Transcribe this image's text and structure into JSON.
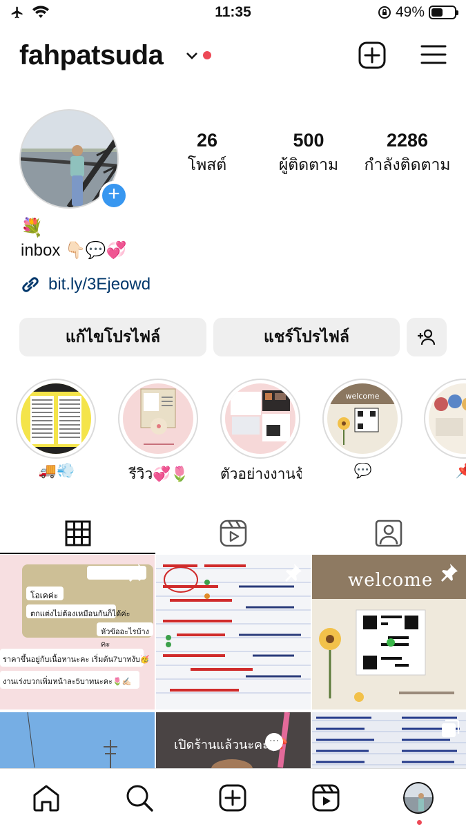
{
  "status_bar": {
    "time": "11:35",
    "battery_text": "49%",
    "battery_level": 0.49
  },
  "header": {
    "username": "fahpatsuda",
    "icons": [
      "chevron-down-icon",
      "new-post-icon",
      "menu-icon"
    ]
  },
  "profile": {
    "stats": [
      {
        "value": "26",
        "label": "โพสต์"
      },
      {
        "value": "500",
        "label": "ผู้ติดตาม"
      },
      {
        "value": "2286",
        "label": "กำลังติดตาม"
      }
    ],
    "bio_emoji": "💐",
    "bio_line": "inbox 👇🏻💬💞",
    "link": "bit.ly/3Ejeowd"
  },
  "buttons": {
    "edit_profile": "แก้ไขโปรไฟล์",
    "share_profile": "แชร์โปรไฟล์"
  },
  "highlights": [
    {
      "label": "🚚💨"
    },
    {
      "label": "รีวิว💞🌷"
    },
    {
      "label": "ตัวอย่างงานจ้..."
    },
    {
      "label": "💬"
    },
    {
      "label": "📌"
    }
  ],
  "tabs": [
    "grid-tab",
    "reels-tab",
    "tagged-tab"
  ],
  "grid": {
    "posts": [
      {
        "text_lines": [
          "โอเคค่ะ",
          "ตกแต่งไม่ต้องเหมือนกันก็ได้ค่ะ",
          "หัวข้ออะไรบ้างคะ",
          "ราคาขึ้นอยู่กับเนื้อหานะคะ เริ่มต้น7บาทงับ🥳",
          "งานเร่งบวกเพิ่มหน้าละ5บาทนะคะ🌷✍🏻"
        ],
        "pinned": true
      },
      {
        "pinned": true
      },
      {
        "title": "welcome",
        "pinned": true
      },
      {},
      {
        "title": "เปิดร้านแล้วนะคะ 📌"
      },
      {}
    ]
  },
  "colors": {
    "accent_blue": "#3897f0",
    "notification_red": "#ed4956",
    "link_blue": "#00376b"
  }
}
